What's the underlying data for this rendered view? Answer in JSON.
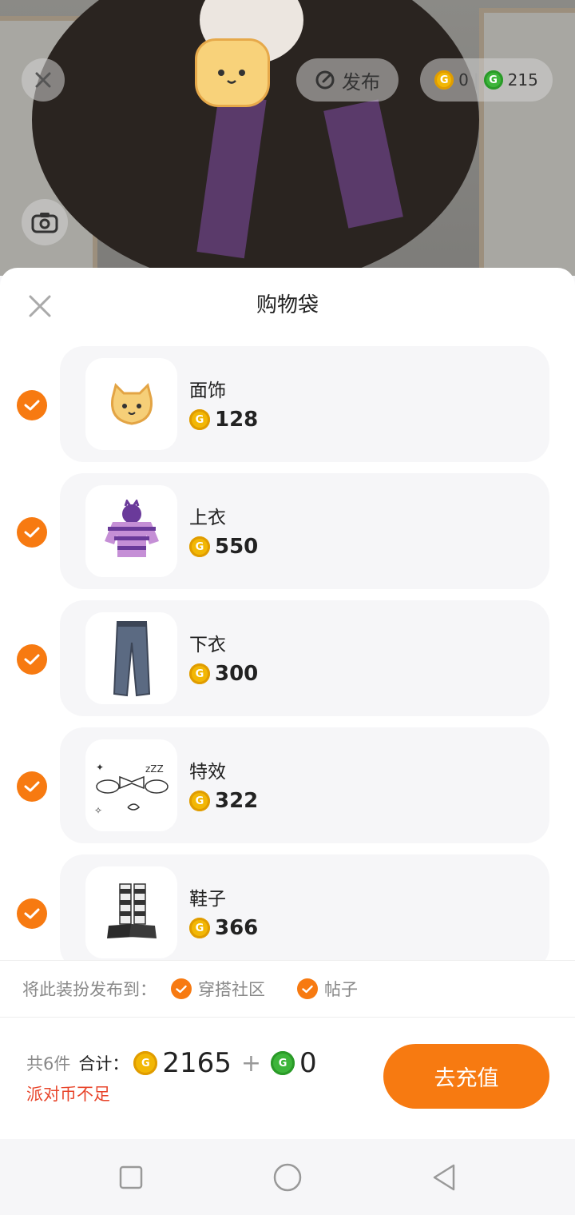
{
  "header": {
    "publish_label": "发布",
    "gold_balance": "0",
    "green_balance": "215"
  },
  "sheet": {
    "title": "购物袋"
  },
  "items": [
    {
      "name": "面饰",
      "price": "128"
    },
    {
      "name": "上衣",
      "price": "550"
    },
    {
      "name": "下衣",
      "price": "300"
    },
    {
      "name": "特效",
      "price": "322"
    },
    {
      "name": "鞋子",
      "price": "366"
    }
  ],
  "share": {
    "label": "将此装扮发布到：",
    "options": [
      "穿搭社区",
      "帖子"
    ]
  },
  "summary": {
    "count": "共6件",
    "total_label": "合计：",
    "gold_total": "2165",
    "plus": "+",
    "green_total": "0",
    "warning": "派对币不足",
    "recharge_label": "去充值"
  },
  "colors": {
    "accent": "#f77a11",
    "warning": "#e8452b",
    "gold_coin": "#f2b705",
    "green_coin": "#3db53a"
  },
  "icons": [
    "close-icon",
    "publish-icon",
    "gold-coin-icon",
    "green-coin-icon",
    "camera-icon",
    "check-icon",
    "square-nav-icon",
    "circle-nav-icon",
    "back-nav-icon"
  ]
}
